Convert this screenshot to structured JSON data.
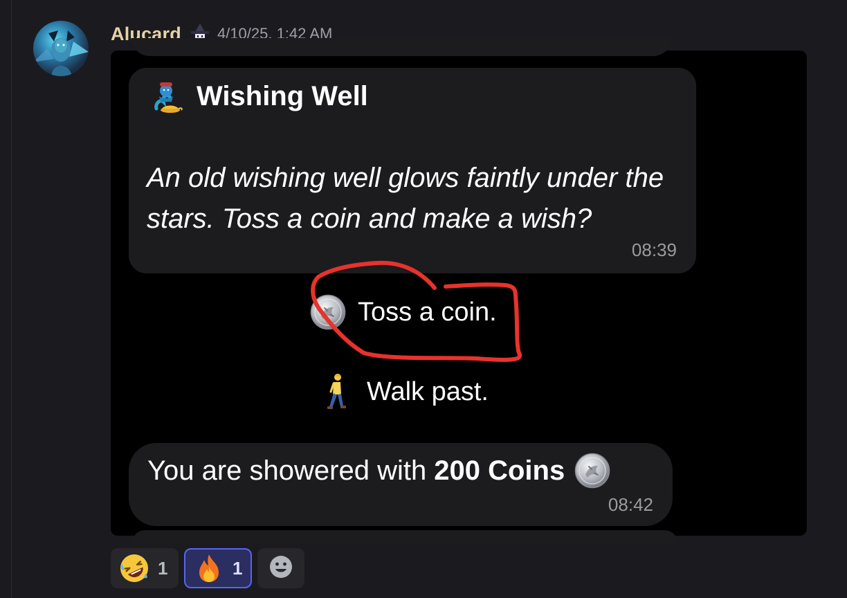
{
  "message": {
    "username": "Alucard",
    "timestamp": "4/10/25, 1:42 AM",
    "author_avatar_icon": "avatar-blue-creature",
    "role_icon": "pixel-wizard-icon"
  },
  "attachment": {
    "card": {
      "icon": "genie-icon",
      "title": "Wishing Well",
      "body": "An old wishing well glows faintly under the stars. Toss a coin and make a wish?",
      "time": "08:39"
    },
    "choices": [
      {
        "icon": "coin-icon",
        "label": "Toss a coin.",
        "highlighted": true
      },
      {
        "icon": "person-walking-icon",
        "label": "Walk past."
      }
    ],
    "reward": {
      "text": "You are showered with",
      "amount": "200 Coins",
      "icon": "coin-icon",
      "time": "08:42"
    },
    "annotation": {
      "type": "red-scribble-circle",
      "color": "#e8322b"
    }
  },
  "reactions": [
    {
      "emoji": "rolling-laughing-icon",
      "count": "1",
      "selected": false
    },
    {
      "emoji": "fire-icon",
      "count": "1",
      "selected": true
    }
  ],
  "add_reaction_icon": "add-reaction-smiley-icon",
  "colors": {
    "background": "#1b1b1f",
    "username": "#e6d3a7",
    "timestamp": "#9ea0a8",
    "bubble": "#1c1c1e",
    "selected_reaction_border": "#5865f2"
  }
}
